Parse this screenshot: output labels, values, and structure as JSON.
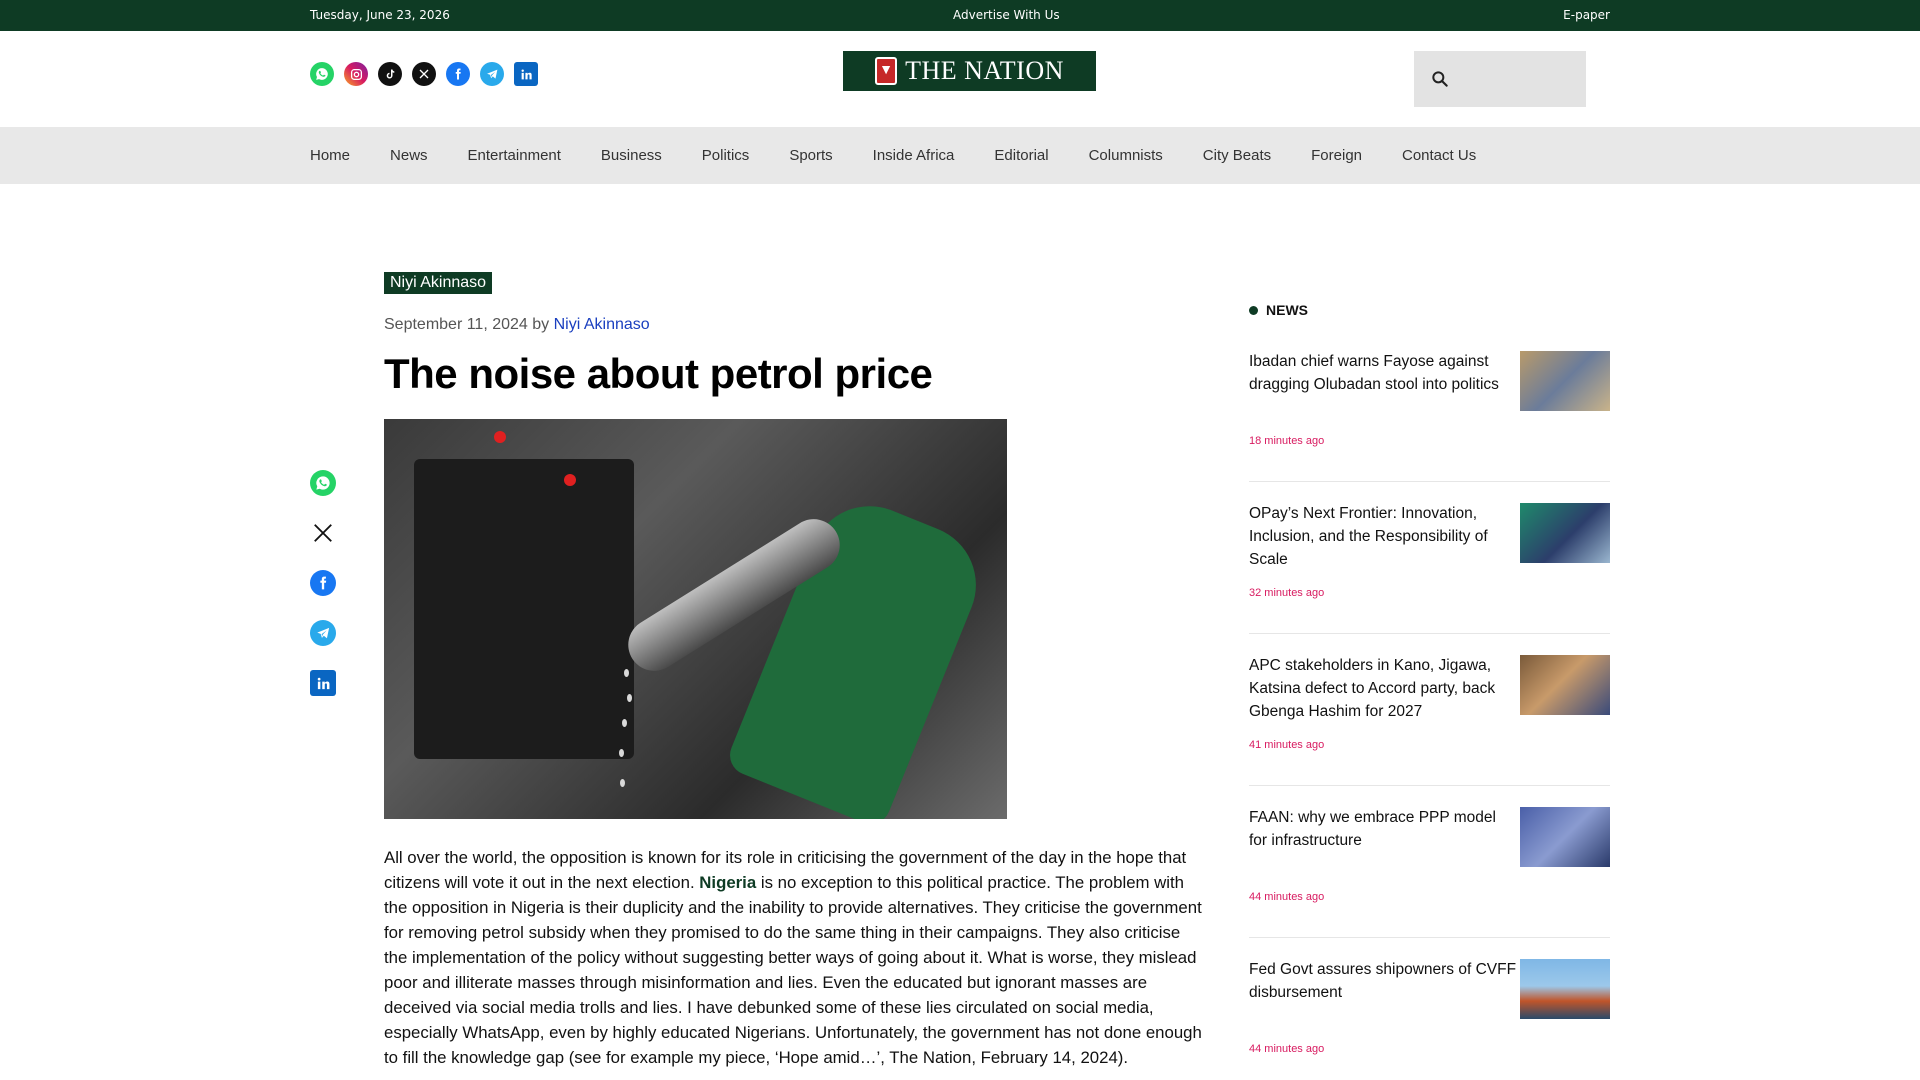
{
  "topbar": {
    "date": "Tuesday, June 23, 2026",
    "advertise": "Advertise With Us",
    "epaper": "E-paper"
  },
  "header": {
    "logo_text": "THE NATION",
    "social_icons": [
      "whatsapp-icon",
      "instagram-icon",
      "tiktok-icon",
      "x-icon",
      "facebook-icon",
      "telegram-icon",
      "linkedin-icon"
    ],
    "search_placeholder": ""
  },
  "nav": {
    "items": [
      "Home",
      "News",
      "Entertainment",
      "Business",
      "Politics",
      "Sports",
      "Inside Africa",
      "Editorial",
      "Columnists",
      "City Beats",
      "Foreign",
      "Contact Us"
    ]
  },
  "article": {
    "category": "Niyi Akinnaso",
    "date": "September 11, 2024",
    "by": "by",
    "author": "Niyi Akinnaso",
    "title": "The noise about petrol price",
    "body_before_link": "All over the world, the opposition is known for its role in criticising the government of the day in the hope that citizens will vote it out in the next election. ",
    "body_link": "Nigeria",
    "body_after_link": " is no exception to this political practice. The problem with the opposition in Nigeria is their duplicity and the inability to provide alternatives. They criticise the government for removing petrol subsidy when they promised to do the same thing in their campaigns. They also criticise the implementation of the policy without suggesting better ways of going about it. What is worse, they mislead poor and illiterate masses through misinformation and lies. Even the educated but ignorant masses are deceived via social media trolls and lies. I have debunked some of these lies circulated on social media, especially WhatsApp, even by highly educated Nigerians. Unfortunately, the government has not done enough to fill the knowledge gap (see for example my piece, ‘Hope amid…’, The Nation, February 14, 2024)."
  },
  "share": {
    "icons": [
      "whatsapp-icon",
      "x-icon",
      "facebook-icon",
      "telegram-icon",
      "linkedin-icon"
    ]
  },
  "sidebar": {
    "heading": "NEWS",
    "items": [
      {
        "title": "Ibadan chief warns Fayose against dragging Olubadan stool into politics",
        "time": "18 minutes ago"
      },
      {
        "title": "OPay’s Next Frontier: Innovation, Inclusion, and the Responsibility of Scale",
        "time": "32 minutes ago"
      },
      {
        "title": "APC stakeholders in Kano, Jigawa, Katsina defect to Accord party, back Gbenga Hashim for 2027",
        "time": "41 minutes ago"
      },
      {
        "title": "FAAN: why we embrace PPP model for infrastructure",
        "time": "44 minutes ago"
      },
      {
        "title": "Fed Govt assures shipowners of CVFF disbursement",
        "time": "44 minutes ago"
      }
    ]
  },
  "colors": {
    "brand_green": "#0e3b24",
    "time_pink": "#d81b60",
    "author_blue": "#1a3fbf"
  }
}
